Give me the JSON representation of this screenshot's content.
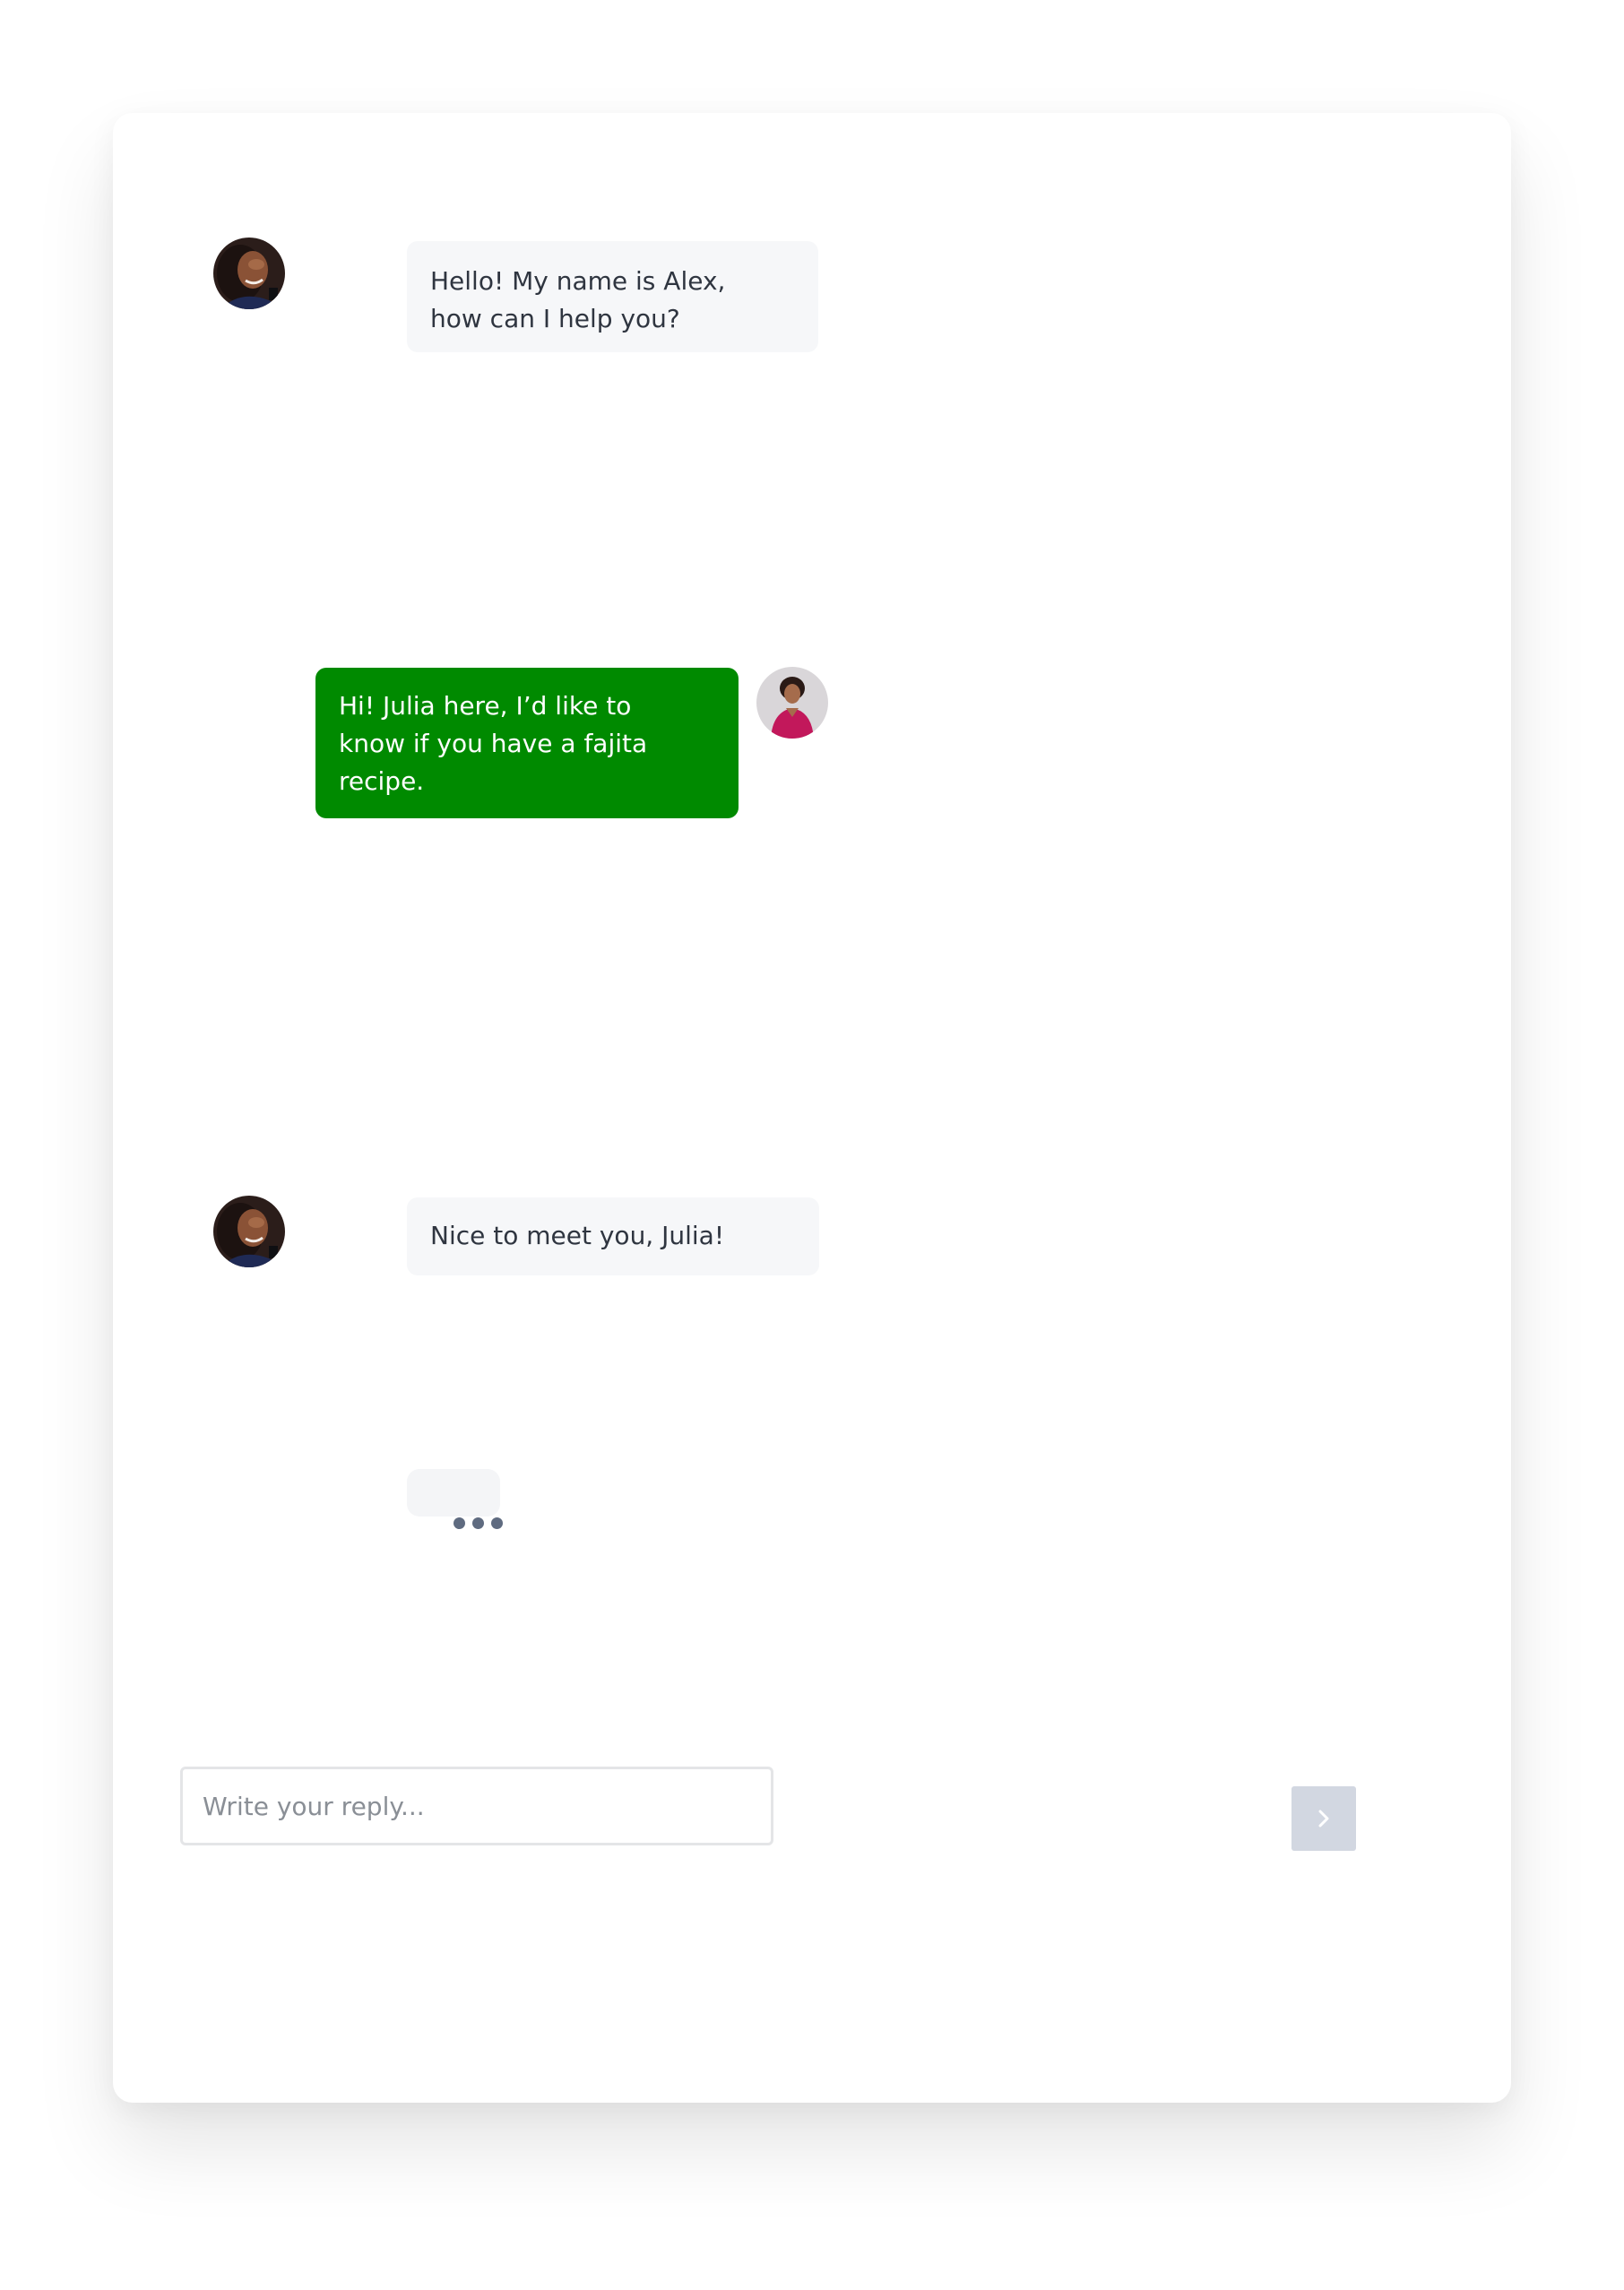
{
  "conversation": {
    "messages": [
      {
        "sender": "bot",
        "avatar": "bot-avatar-photo",
        "text_lines": [
          "Hello! My name is Alex,",
          "how can I help you?"
        ]
      },
      {
        "sender": "user",
        "avatar": "user-avatar-photo",
        "text_lines": [
          "Hi! Julia here, I’d like to",
          "know if you have a fajita",
          "recipe."
        ]
      },
      {
        "sender": "bot",
        "avatar": "bot-avatar-photo",
        "text_lines": [
          "Nice to meet you, Julia!"
        ]
      }
    ],
    "typing_indicator": {
      "icon": "typing-dots-icon"
    }
  },
  "composer": {
    "placeholder": "Write your reply...",
    "value": "",
    "send_icon": "chevron-right-icon"
  },
  "colors": {
    "user_bubble": "#008a00",
    "bot_bubble": "#f6f7f9",
    "send_button": "#d2d7e1",
    "text": "#2f3540",
    "typing_dots": "#5f6b80"
  }
}
